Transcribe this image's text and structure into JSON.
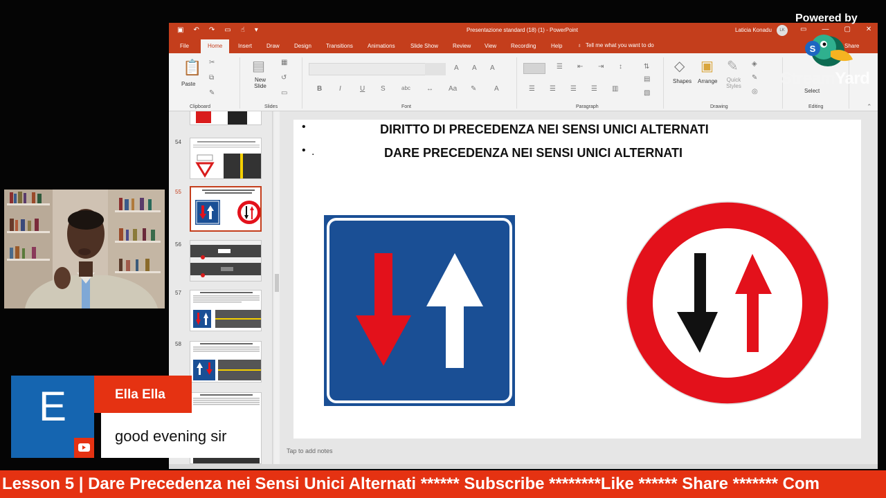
{
  "ppt": {
    "doc_title": "Presentazione standard (18) (1)  -  PowerPoint",
    "user_name": "Laticia Konadu",
    "user_initials": "LK",
    "tabs": [
      "File",
      "Home",
      "Insert",
      "Draw",
      "Design",
      "Transitions",
      "Animations",
      "Slide Show",
      "Review",
      "View",
      "Recording",
      "Help"
    ],
    "tell_me": "Tell me what you want to do",
    "share_label": "Share",
    "ribbon": {
      "paste": "Paste",
      "new_slide": "New Slide",
      "shapes": "Shapes",
      "arrange": "Arrange",
      "quick_styles": "Quick Styles",
      "select": "Select",
      "groups": [
        "Clipboard",
        "Slides",
        "Font",
        "Paragraph",
        "Drawing",
        "Editing"
      ]
    },
    "thumbnails": [
      {
        "number": "54",
        "selected": false
      },
      {
        "number": "55",
        "selected": true
      },
      {
        "number": "56",
        "selected": false
      },
      {
        "number": "57",
        "selected": false
      },
      {
        "number": "58",
        "selected": false
      }
    ],
    "slide": {
      "bullet1": "DIRITTO DI PRECEDENZA NEI SENSI UNICI ALTERNATI",
      "bullet2": "DARE PRECEDENZA NEI SENSI UNICI ALTERNATI",
      "bullet2_prefix": ".",
      "colors": {
        "blue_sign": "#1a4f95",
        "red": "#e3111b",
        "white": "#ffffff",
        "black": "#111111"
      }
    },
    "notes_placeholder": "Tap to add notes"
  },
  "overlay": {
    "powered_by": "Powered by",
    "brand_stream": "Stream",
    "brand_yard": "Yard",
    "brand_icon": "duck-logo-icon"
  },
  "comment": {
    "avatar_letter": "E",
    "name": "Ella Ella",
    "message": "good evening sir",
    "source_icon": "youtube-icon"
  },
  "ticker": {
    "text": "Lesson 5 | Dare Precedenza nei Sensi Unici Alternati ****** Subscribe ********Like ****** Share ******* Com"
  }
}
